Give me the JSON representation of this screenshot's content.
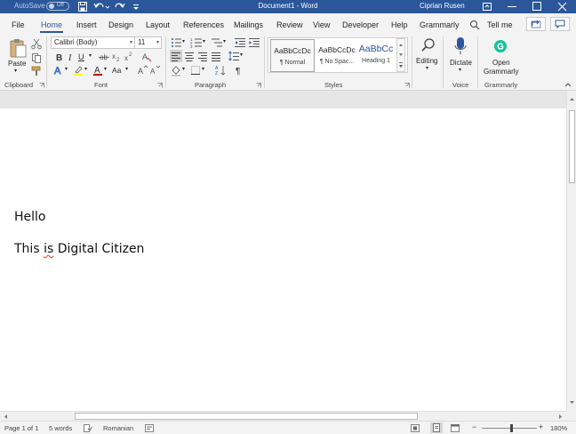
{
  "titlebar": {
    "autosave_label": "AutoSave",
    "autosave_state": "Off",
    "document_title": "Document1  -  Word",
    "user_name": "Ciprian Rusen"
  },
  "tabs": [
    {
      "label": "File",
      "active": false
    },
    {
      "label": "Home",
      "active": true
    },
    {
      "label": "Insert",
      "active": false
    },
    {
      "label": "Design",
      "active": false
    },
    {
      "label": "Layout",
      "active": false
    },
    {
      "label": "References",
      "active": false
    },
    {
      "label": "Mailings",
      "active": false
    },
    {
      "label": "Review",
      "active": false
    },
    {
      "label": "View",
      "active": false
    },
    {
      "label": "Developer",
      "active": false
    },
    {
      "label": "Help",
      "active": false
    },
    {
      "label": "Grammarly",
      "active": false
    },
    {
      "label": "Tell me",
      "active": false
    }
  ],
  "ribbon": {
    "clipboard": {
      "label": "Clipboard",
      "paste_label": "Paste"
    },
    "font": {
      "label": "Font",
      "font_name": "Calibri (Body)",
      "font_size": "11",
      "change_case": "Aa"
    },
    "paragraph": {
      "label": "Paragraph"
    },
    "styles": {
      "label": "Styles",
      "items": [
        {
          "sample": "AaBbCcDc",
          "name": "¶ Normal"
        },
        {
          "sample": "AaBbCcDc",
          "name": "¶ No Spac..."
        },
        {
          "sample": "AaBbCc",
          "name": "Heading 1"
        }
      ]
    },
    "editing": {
      "label": "Editing"
    },
    "voice": {
      "label": "Voice",
      "dictate_label": "Dictate"
    },
    "grammarly": {
      "label": "Grammarly",
      "open_label_1": "Open",
      "open_label_2": "Grammarly"
    }
  },
  "document": {
    "line1": "Hello",
    "line2_before": "This ",
    "line2_misspelled": "is",
    "line2_after": " Digital Citizen"
  },
  "statusbar": {
    "page": "Page 1 of 1",
    "words": "5 words",
    "language": "Romanian",
    "zoom_minus": "−",
    "zoom_plus": "+",
    "zoom": "180%"
  },
  "colors": {
    "accent": "#2b579a",
    "font_color": "#c00000",
    "highlight": "#ffff00",
    "text_effects": "#4472c4",
    "grammarly": "#15c39a",
    "heading_style": "#2f5496"
  }
}
